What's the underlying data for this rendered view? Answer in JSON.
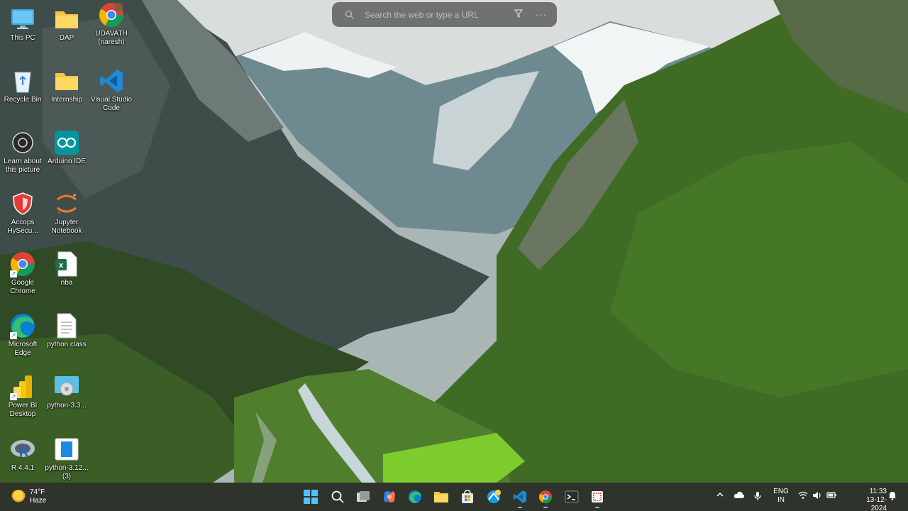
{
  "search": {
    "placeholder": "Search the web or type a URL"
  },
  "desktop_icons": [
    {
      "label": "This PC",
      "icon": "monitor-icon"
    },
    {
      "label": "DAP",
      "icon": "folder-icon"
    },
    {
      "label": "UDAVATH (naresh)",
      "icon": "chrome-profile-icon"
    },
    {
      "label": "Recycle Bin",
      "icon": "recycle-bin-icon"
    },
    {
      "label": "Internship",
      "icon": "folder-icon"
    },
    {
      "label": "Visual Studio Code",
      "icon": "vscode-icon"
    },
    {
      "label": "Learn about this picture",
      "icon": "camera-icon"
    },
    {
      "label": "Arduino IDE",
      "icon": "arduino-icon"
    },
    {
      "label": "Accops HySecu...",
      "icon": "shield-icon"
    },
    {
      "label": "Jupyter Notebook",
      "icon": "jupyter-icon"
    },
    {
      "label": "Google Chrome",
      "icon": "chrome-icon"
    },
    {
      "label": "nba",
      "icon": "excel-icon"
    },
    {
      "label": "Microsoft Edge",
      "icon": "edge-icon"
    },
    {
      "label": "python class",
      "icon": "document-icon"
    },
    {
      "label": "Power BI Desktop",
      "icon": "powerbi-icon"
    },
    {
      "label": "python-3.3...",
      "icon": "installer-icon"
    },
    {
      "label": "R 4.4.1",
      "icon": "r-icon"
    },
    {
      "label": "python-3.12... (3)",
      "icon": "installer-icon"
    }
  ],
  "taskbar": {
    "weather_temp": "74°F",
    "weather_desc": "Haze",
    "lang_line1": "ENG",
    "lang_line2": "IN",
    "time": "11:33",
    "date": "13-12-2024"
  },
  "colors": {
    "taskbar_bg": "#1c221a",
    "accent": "#8fb4ff"
  }
}
